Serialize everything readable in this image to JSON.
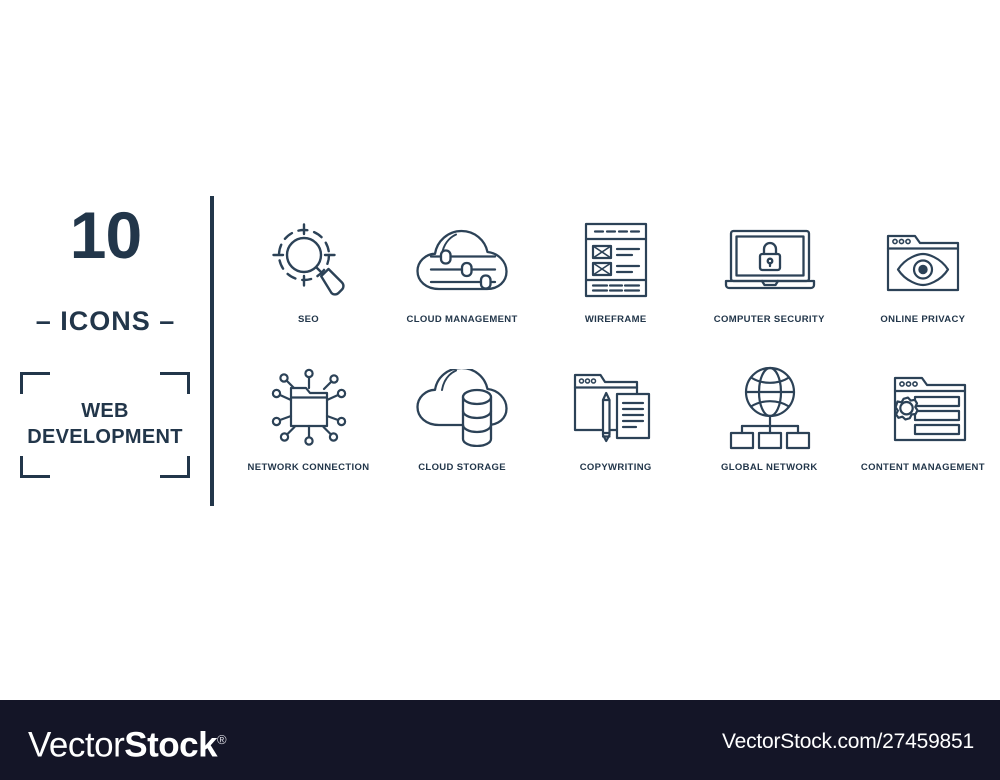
{
  "theme": {
    "ink": "#22364a",
    "stroke": "#2c4257",
    "background": "#ffffff",
    "footer_background": "#141527",
    "footer_text": "#ffffff"
  },
  "title_block": {
    "count_number": "10",
    "count_word": "– ICONS –",
    "set_title": "WEB\nDEVELOPMENT",
    "set_title_line1": "WEB",
    "set_title_line2": "DEVELOPMENT"
  },
  "icons": [
    {
      "label": "SEO",
      "icon": "magnifier-crosshair-icon"
    },
    {
      "label": "CLOUD MANAGEMENT",
      "icon": "cloud-sliders-icon"
    },
    {
      "label": "WIREFRAME",
      "icon": "wireframe-layout-icon"
    },
    {
      "label": "COMPUTER SECURITY",
      "icon": "laptop-padlock-icon"
    },
    {
      "label": "ONLINE PRIVACY",
      "icon": "browser-eye-icon"
    },
    {
      "label": "NETWORK CONNECTION",
      "icon": "folder-nodes-icon"
    },
    {
      "label": "CLOUD STORAGE",
      "icon": "cloud-database-icon"
    },
    {
      "label": "COPYWRITING",
      "icon": "browser-pencil-document-icon"
    },
    {
      "label": "GLOBAL NETWORK",
      "icon": "globe-hierarchy-icon"
    },
    {
      "label": "CONTENT MANAGEMENT",
      "icon": "browser-gear-bars-icon"
    }
  ],
  "footer": {
    "brand_thin": "Vector",
    "brand_bold": "Stock",
    "brand_registered": "®",
    "url": "VectorStock.com/27459851"
  }
}
